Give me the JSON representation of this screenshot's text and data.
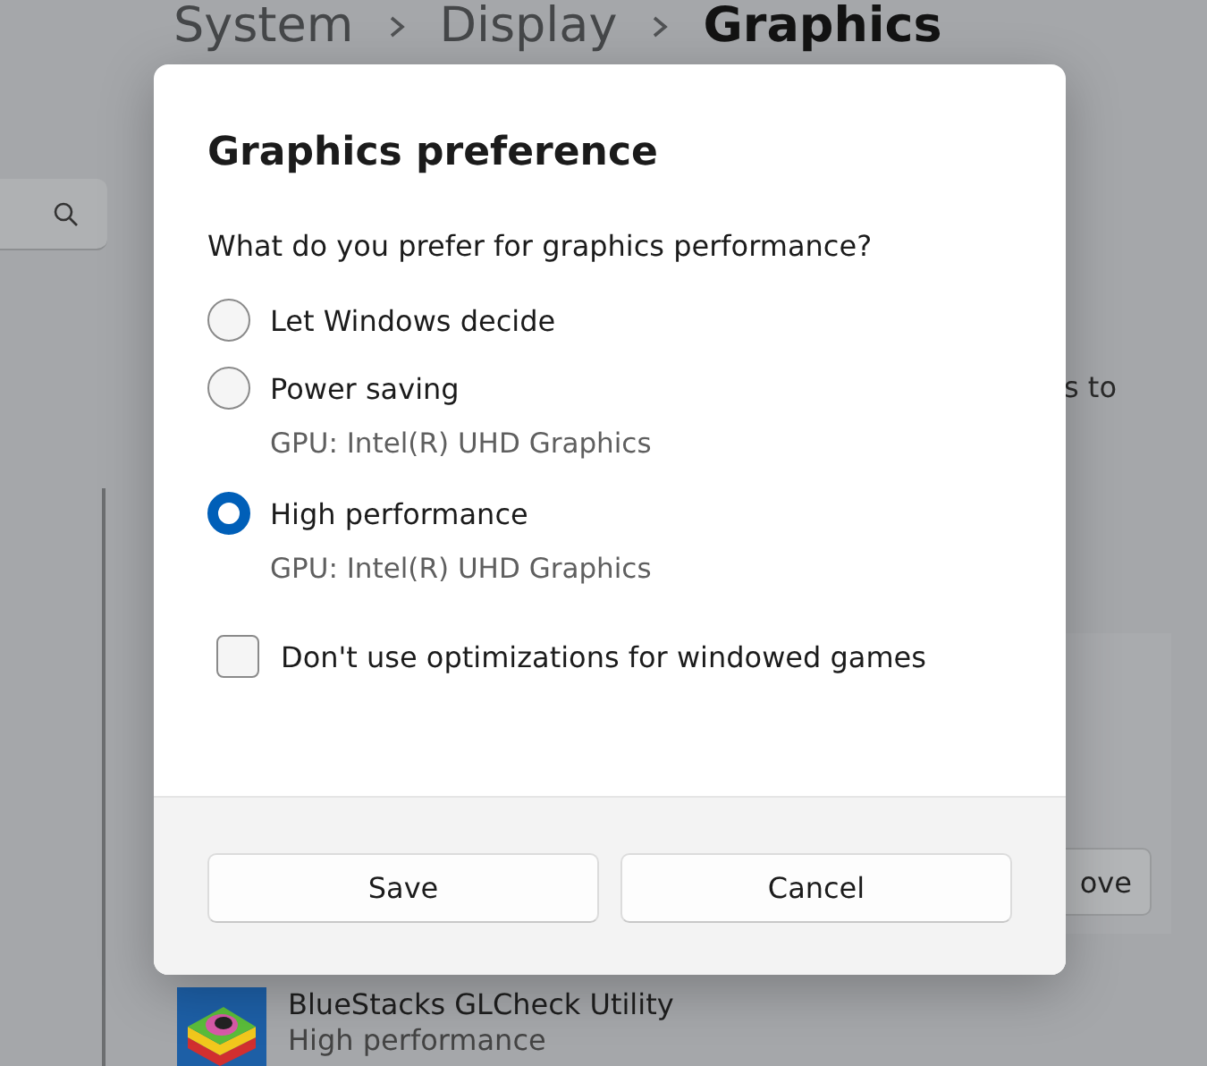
{
  "breadcrumb": [
    {
      "label": "System",
      "current": false
    },
    {
      "label": "Display",
      "current": false
    },
    {
      "label": "Graphics",
      "current": true
    }
  ],
  "background_text": "s to",
  "background_button": "ove",
  "apps": [
    {
      "name": "BlueStacks GLCheck Utility",
      "preference": "High performance"
    }
  ],
  "dialog": {
    "title": "Graphics preference",
    "question": "What do you prefer for graphics performance?",
    "options": [
      {
        "label": "Let Windows decide",
        "selected": false
      },
      {
        "label": "Power saving",
        "detail": "GPU: Intel(R) UHD Graphics",
        "selected": false
      },
      {
        "label": "High performance",
        "detail": "GPU: Intel(R) UHD Graphics",
        "selected": true
      }
    ],
    "checkbox": {
      "label": "Don't use optimizations for windowed games",
      "checked": false
    },
    "buttons": [
      "Save",
      "Cancel"
    ]
  }
}
